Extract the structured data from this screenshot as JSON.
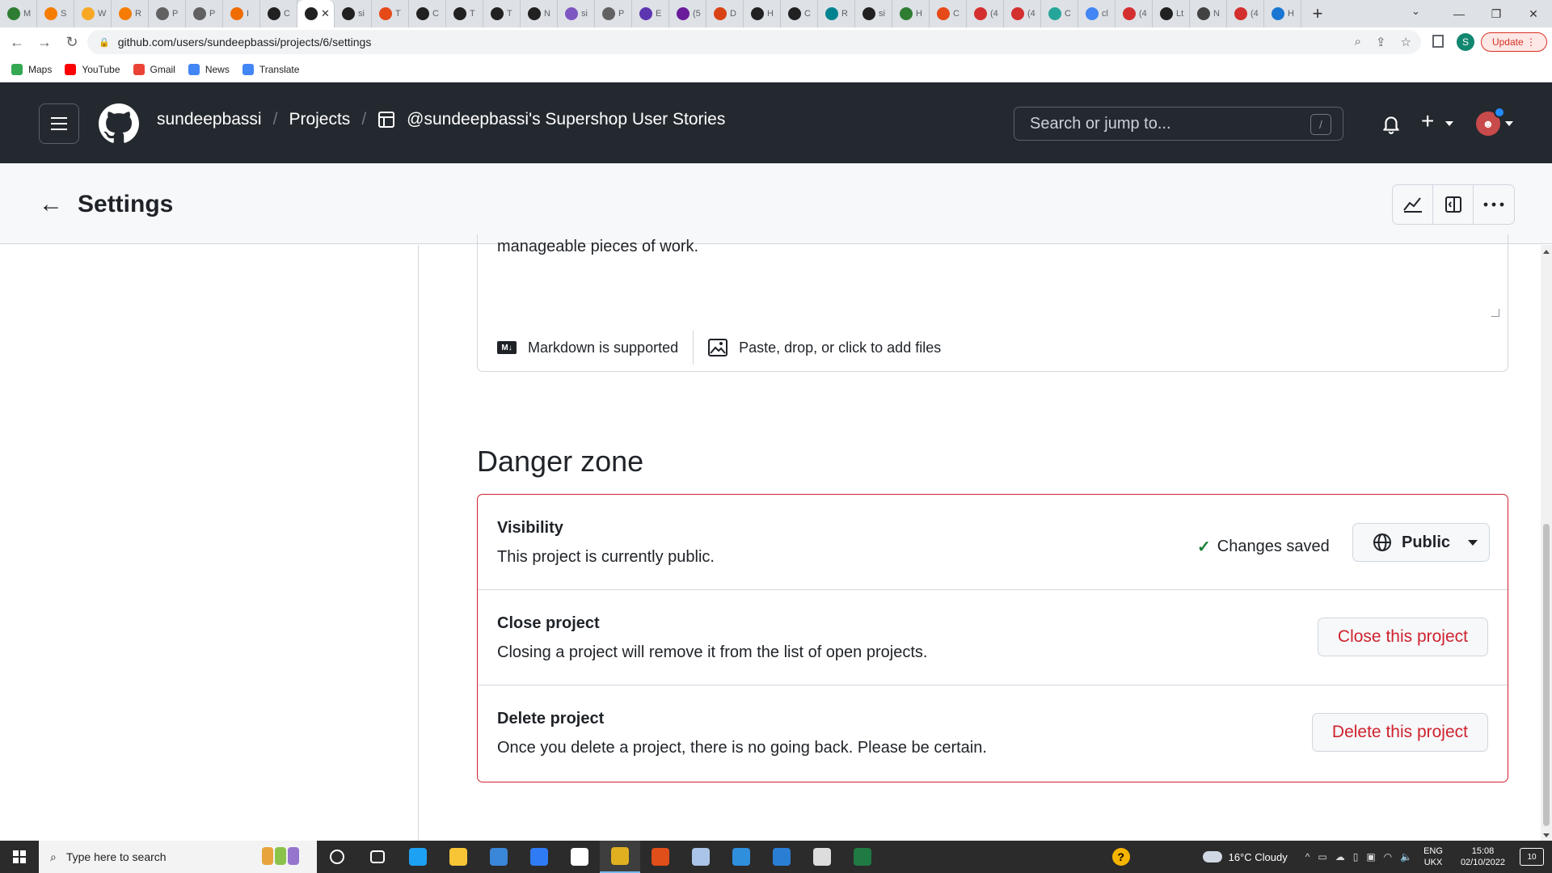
{
  "browser": {
    "tabs": [
      {
        "letter": "M",
        "color": "#2e7d32"
      },
      {
        "letter": "S",
        "color": "#f57c00"
      },
      {
        "letter": "W",
        "color": "#f9a825"
      },
      {
        "letter": "R",
        "color": "#f57c00"
      },
      {
        "letter": "P",
        "color": "#616161"
      },
      {
        "letter": "P",
        "color": "#616161"
      },
      {
        "letter": "I",
        "color": "#ef6c00"
      },
      {
        "letter": "C",
        "color": "#212121"
      },
      {
        "letter": "",
        "color": "#212121",
        "active": true
      },
      {
        "letter": "si",
        "color": "#212121"
      },
      {
        "letter": "T",
        "color": "#e64a19"
      },
      {
        "letter": "C",
        "color": "#212121"
      },
      {
        "letter": "T",
        "color": "#212121"
      },
      {
        "letter": "T",
        "color": "#212121"
      },
      {
        "letter": "N",
        "color": "#212121"
      },
      {
        "letter": "si",
        "color": "#7e57c2"
      },
      {
        "letter": "P",
        "color": "#616161"
      },
      {
        "letter": "E",
        "color": "#5e35b1"
      },
      {
        "letter": "(5",
        "color": "#6a1b9a"
      },
      {
        "letter": "D",
        "color": "#d84315"
      },
      {
        "letter": "H",
        "color": "#212121"
      },
      {
        "letter": "C",
        "color": "#212121"
      },
      {
        "letter": "R",
        "color": "#00838f"
      },
      {
        "letter": "si",
        "color": "#212121"
      },
      {
        "letter": "H",
        "color": "#2e7d32"
      },
      {
        "letter": "C",
        "color": "#e64a19"
      },
      {
        "letter": "(4",
        "color": "#d32f2f"
      },
      {
        "letter": "(4",
        "color": "#d32f2f"
      },
      {
        "letter": "C",
        "color": "#26a69a"
      },
      {
        "letter": "cl",
        "color": "#4285f4"
      },
      {
        "letter": "(4",
        "color": "#d32f2f"
      },
      {
        "letter": "Lt",
        "color": "#212121"
      },
      {
        "letter": "N",
        "color": "#424242"
      },
      {
        "letter": "(4",
        "color": "#d32f2f"
      },
      {
        "letter": "H",
        "color": "#1976d2"
      }
    ],
    "new_tab": "+",
    "url": "github.com/users/sundeepbassi/projects/6/settings",
    "update_label": "Update",
    "profile_initial": "S",
    "bookmarks": [
      {
        "label": "Maps",
        "color": "#34a853"
      },
      {
        "label": "YouTube",
        "color": "#ff0000"
      },
      {
        "label": "Gmail",
        "color": "#ea4335"
      },
      {
        "label": "News",
        "color": "#4285f4"
      },
      {
        "label": "Translate",
        "color": "#4285f4"
      }
    ]
  },
  "github": {
    "user": "sundeepbassi",
    "projects_label": "Projects",
    "project_title": "@sundeepbassi's Supershop User Stories",
    "search_placeholder": "Search or jump to...",
    "search_shortcut": "/"
  },
  "settings": {
    "title": "Settings",
    "description_tail": "manageable pieces of work.",
    "markdown_note": "Markdown is supported",
    "attach_note": "Paste, drop, or click to add files",
    "danger_zone": {
      "heading": "Danger zone",
      "visibility": {
        "title": "Visibility",
        "description": "This project is currently public.",
        "status": "Changes saved",
        "button": "Public"
      },
      "close": {
        "title": "Close project",
        "description": "Closing a project will remove it from the list of open projects.",
        "button": "Close this project"
      },
      "delete": {
        "title": "Delete project",
        "description": "Once you delete a project, there is no going back. Please be certain.",
        "button": "Delete this project"
      }
    }
  },
  "taskbar": {
    "search_placeholder": "Type here to search",
    "weather": "16°C  Cloudy",
    "lang_line1": "ENG",
    "lang_line2": "UKX",
    "time": "15:08",
    "date": "02/10/2022",
    "notifications": "10",
    "apps": [
      {
        "name": "cortana",
        "color": "#ffffff"
      },
      {
        "name": "task-view",
        "color": "#ffffff"
      },
      {
        "name": "edge",
        "color": "#1da1f2"
      },
      {
        "name": "file-explorer",
        "color": "#f8c537"
      },
      {
        "name": "mail",
        "color": "#3a86d8"
      },
      {
        "name": "dropbox",
        "color": "#2f7bf5"
      },
      {
        "name": "github-desktop",
        "color": "#ffffff"
      },
      {
        "name": "chrome",
        "color": "#e0b020",
        "active": true
      },
      {
        "name": "office",
        "color": "#e04e1a"
      },
      {
        "name": "notepad",
        "color": "#a9c4e6"
      },
      {
        "name": "vscode",
        "color": "#2f8fdd"
      },
      {
        "name": "photos",
        "color": "#2a7fd4"
      },
      {
        "name": "app-window",
        "color": "#dddddd"
      },
      {
        "name": "excel",
        "color": "#1f7a43"
      }
    ]
  }
}
